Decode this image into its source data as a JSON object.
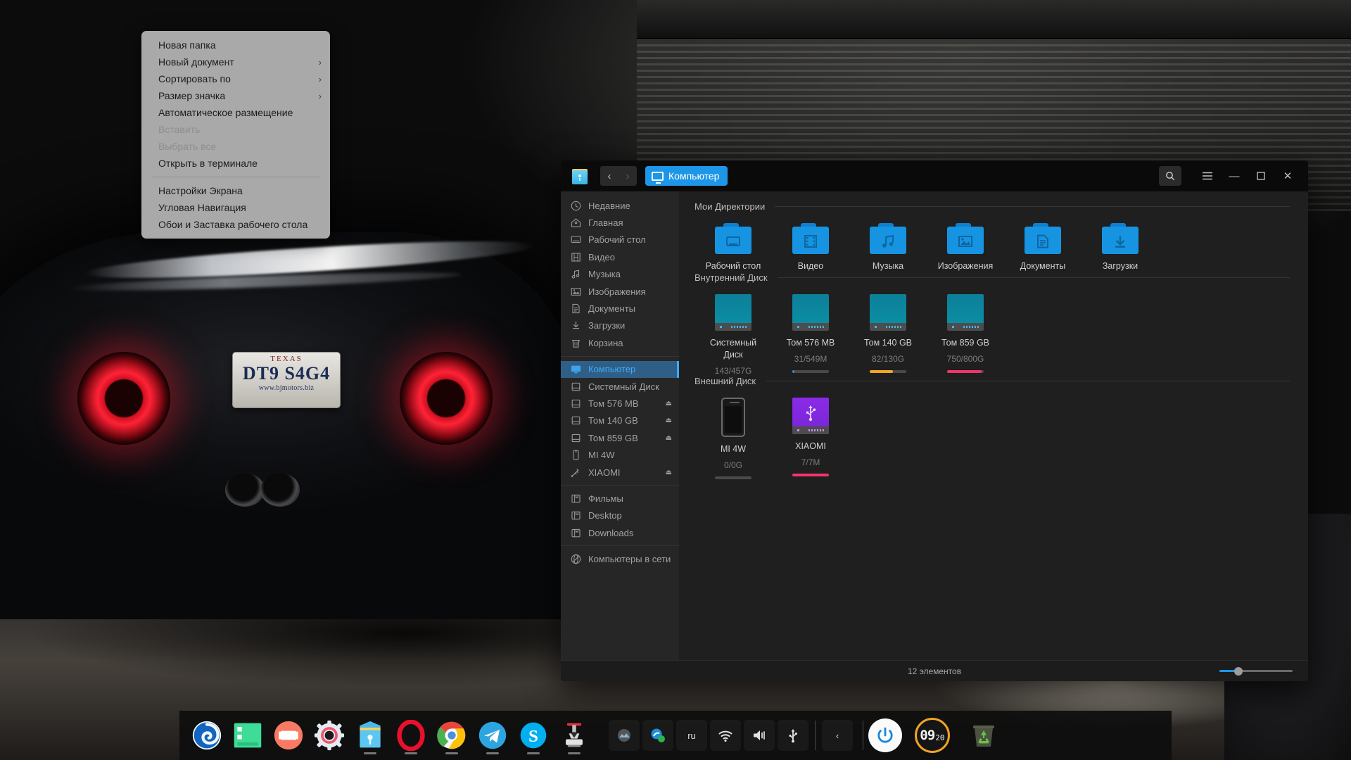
{
  "desktop": {
    "license_plate": {
      "top": "TEXAS",
      "number": "DT9 S4G4",
      "bottom": "www.bjmotors.biz"
    }
  },
  "context_menu": {
    "items": [
      {
        "label": "Новая папка",
        "submenu": false,
        "disabled": false
      },
      {
        "label": "Новый документ",
        "submenu": true,
        "disabled": false
      },
      {
        "label": "Сортировать по",
        "submenu": true,
        "disabled": false
      },
      {
        "label": "Размер значка",
        "submenu": true,
        "disabled": false
      },
      {
        "label": "Автоматическое размещение",
        "submenu": false,
        "disabled": false
      },
      {
        "label": "Вставить",
        "submenu": false,
        "disabled": true
      },
      {
        "label": "Выбрать все",
        "submenu": false,
        "disabled": true
      },
      {
        "label": "Открыть в терминале",
        "submenu": false,
        "disabled": false
      },
      {
        "separator": true
      },
      {
        "label": "Настройки Экрана",
        "submenu": false,
        "disabled": false
      },
      {
        "label": "Угловая Навигация",
        "submenu": false,
        "disabled": false
      },
      {
        "label": "Обои и Заставка рабочего стола",
        "submenu": false,
        "disabled": false
      }
    ]
  },
  "file_manager": {
    "titlebar": {
      "app_icon": "file-manager-icon",
      "back_label": "‹",
      "forward_label": "›",
      "breadcrumb": "Компьютер",
      "search_icon": "search-icon",
      "menu_icon": "hamburger-menu-icon",
      "minimize_label": "—",
      "maximize_label": "▢",
      "close_label": "✕",
      "accent_color": "#1e96e8"
    },
    "sidebar": {
      "groups": [
        {
          "items": [
            {
              "label": "Недавние",
              "icon": "clock-icon",
              "active": false,
              "eject": false
            },
            {
              "label": "Главная",
              "icon": "home-icon",
              "active": false,
              "eject": false
            },
            {
              "label": "Рабочий стол",
              "icon": "desktop-icon",
              "active": false,
              "eject": false
            },
            {
              "label": "Видео",
              "icon": "video-icon",
              "active": false,
              "eject": false
            },
            {
              "label": "Музыка",
              "icon": "music-icon",
              "active": false,
              "eject": false
            },
            {
              "label": "Изображения",
              "icon": "image-icon",
              "active": false,
              "eject": false
            },
            {
              "label": "Документы",
              "icon": "document-icon",
              "active": false,
              "eject": false
            },
            {
              "label": "Загрузки",
              "icon": "download-icon",
              "active": false,
              "eject": false
            },
            {
              "label": "Корзина",
              "icon": "trash-icon",
              "active": false,
              "eject": false
            }
          ]
        },
        {
          "items": [
            {
              "label": "Компьютер",
              "icon": "computer-icon",
              "active": true,
              "eject": false
            },
            {
              "label": "Системный Диск",
              "icon": "drive-icon",
              "active": false,
              "eject": false
            },
            {
              "label": "Том 576 MB",
              "icon": "drive-icon",
              "active": false,
              "eject": true
            },
            {
              "label": "Том 140 GB",
              "icon": "drive-icon",
              "active": false,
              "eject": true
            },
            {
              "label": "Том 859 GB",
              "icon": "drive-icon",
              "active": false,
              "eject": true
            },
            {
              "label": "MI 4W",
              "icon": "phone-icon",
              "active": false,
              "eject": false
            },
            {
              "label": "XIAOMI",
              "icon": "usb-icon",
              "active": false,
              "eject": true
            }
          ]
        },
        {
          "items": [
            {
              "label": "Фильмы",
              "icon": "bookmark-folder-icon",
              "active": false,
              "eject": false
            },
            {
              "label": "Desktop",
              "icon": "bookmark-folder-icon",
              "active": false,
              "eject": false
            },
            {
              "label": "Downloads",
              "icon": "bookmark-folder-icon",
              "active": false,
              "eject": false
            }
          ]
        },
        {
          "items": [
            {
              "label": "Компьютеры в сети",
              "icon": "network-icon",
              "active": false,
              "eject": false
            }
          ]
        }
      ]
    },
    "sections": [
      {
        "title": "Мои Директории",
        "kind": "folders",
        "items": [
          {
            "label": "Рабочий стол",
            "emblem": "desktop-icon"
          },
          {
            "label": "Видео",
            "emblem": "film-icon"
          },
          {
            "label": "Музыка",
            "emblem": "note-icon"
          },
          {
            "label": "Изображения",
            "emblem": "picture-icon"
          },
          {
            "label": "Документы",
            "emblem": "document-icon"
          },
          {
            "label": "Загрузки",
            "emblem": "download-icon"
          }
        ]
      },
      {
        "title": "Внутренний Диск",
        "kind": "drives",
        "items": [
          {
            "label": "Системный Диск",
            "usage": "143/457G",
            "percent": 31,
            "bar_color": "",
            "icon": "hdd-icon"
          },
          {
            "label": "Том 576 MB",
            "usage": "31/549M",
            "percent": 6,
            "bar_color": "#1e96e8",
            "icon": "hdd-icon"
          },
          {
            "label": "Том 140 GB",
            "usage": "82/130G",
            "percent": 63,
            "bar_color": "#f5a623",
            "icon": "hdd-icon"
          },
          {
            "label": "Том 859 GB",
            "usage": "750/800G",
            "percent": 94,
            "bar_color": "#f5336b",
            "icon": "hdd-icon"
          }
        ]
      },
      {
        "title": "Внешний Диск",
        "kind": "external",
        "items": [
          {
            "label": "MI 4W",
            "usage": "0/0G",
            "percent": 0,
            "bar_color": "",
            "icon": "phone-icon"
          },
          {
            "label": "XIAOMI",
            "usage": "7/7M",
            "percent": 100,
            "bar_color": "#f5336b",
            "icon": "usb-drive-icon"
          }
        ]
      }
    ],
    "status": {
      "item_count_text": "12 элементов",
      "zoom_label": "icon-size-slider"
    }
  },
  "dock": {
    "apps": [
      {
        "name": "deepin-launcher-icon",
        "running": false
      },
      {
        "name": "terminal-icon",
        "running": false
      },
      {
        "name": "movie-player-icon",
        "running": false
      },
      {
        "name": "settings-icon",
        "running": false
      },
      {
        "name": "file-manager-icon",
        "running": true
      },
      {
        "name": "opera-icon",
        "running": true
      },
      {
        "name": "chrome-icon",
        "running": true
      },
      {
        "name": "telegram-icon",
        "running": true
      },
      {
        "name": "skype-icon",
        "running": true
      },
      {
        "name": "downloader-icon",
        "running": true
      }
    ],
    "tray": [
      {
        "name": "tray-app-icon",
        "label": ""
      },
      {
        "name": "tray-status-icon",
        "label": ""
      },
      {
        "name": "keyboard-layout",
        "label": "ru"
      },
      {
        "name": "wifi-icon",
        "label": ""
      },
      {
        "name": "volume-icon",
        "label": ""
      },
      {
        "name": "usb-icon",
        "label": ""
      }
    ],
    "tray_expand_label": "‹",
    "power_icon": "power-icon",
    "clock": {
      "hours": "09",
      "minutes": "20",
      "ring_color": "#f0a326"
    },
    "trash_icon": "recycle-bin-icon"
  }
}
